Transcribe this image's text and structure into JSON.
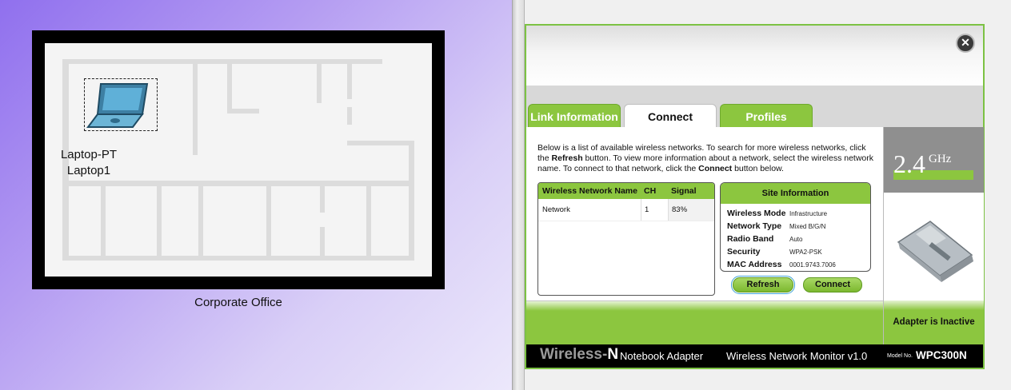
{
  "workspace": {
    "device_type": "Laptop-PT",
    "device_name": "Laptop1",
    "location_label": "Corporate Office"
  },
  "app": {
    "close_symbol": "✕",
    "tabs": [
      {
        "label": "Link Information",
        "active": false
      },
      {
        "label": "Connect",
        "active": true
      },
      {
        "label": "Profiles",
        "active": false
      }
    ],
    "description": {
      "part1": "Below is a list of available wireless networks. To search for more wireless networks, click the ",
      "refresh_word": "Refresh",
      "part2": " button. To view more information about a network, select the wireless network name. To connect to that network, click the ",
      "connect_word": "Connect",
      "part3": " button below."
    },
    "network_table": {
      "headers": [
        "Wireless Network Name",
        "CH",
        "Signal"
      ],
      "rows": [
        {
          "name": "Network",
          "ch": "1",
          "signal": "83%"
        }
      ]
    },
    "site_info": {
      "title": "Site Information",
      "fields": [
        {
          "label": "Wireless Mode",
          "value": "Infrastructure"
        },
        {
          "label": "Network Type",
          "value": "Mixed B/G/N"
        },
        {
          "label": "Radio Band",
          "value": "Auto"
        },
        {
          "label": "Security",
          "value": "WPA2-PSK"
        },
        {
          "label": "MAC Address",
          "value": "0001.9743.7006"
        }
      ]
    },
    "buttons": {
      "refresh": "Refresh",
      "connect": "Connect"
    },
    "band": {
      "number": "2.4",
      "unit": "GHz"
    },
    "adapter_status": "Adapter is Inactive",
    "footer": {
      "brand_main": "Wireless-",
      "brand_n": "N",
      "brand_rest": "Notebook Adapter",
      "monitor": "Wireless Network Monitor  v1.0",
      "model_label": "Model No.",
      "model": "WPC300N"
    }
  },
  "colors": {
    "accent_green": "#8cc63f",
    "background_purple": "#9070ee"
  }
}
